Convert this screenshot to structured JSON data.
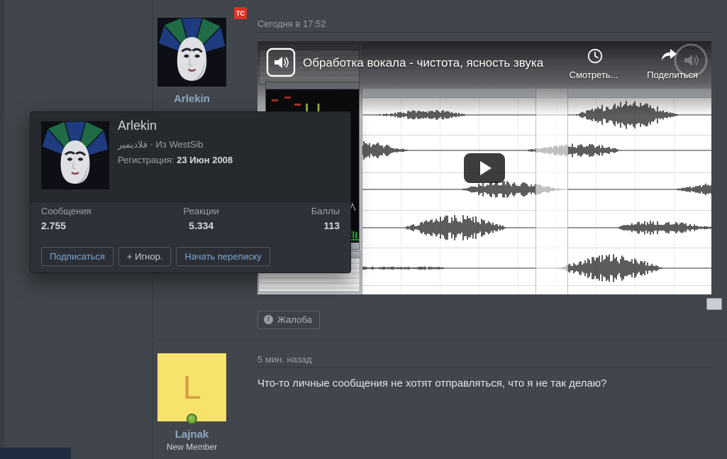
{
  "badge": {
    "label": "TC"
  },
  "post1": {
    "author": {
      "name": "Arlekin"
    },
    "timestamp": "Сегодня в 17:52",
    "video": {
      "title": "Обработка вокала - чистота, ясность звука",
      "watch_later_label": "Смотреть...",
      "share_label": "Поделиться"
    },
    "report_label": "Жалоба"
  },
  "profile_card": {
    "name": "Arlekin",
    "subtitle": "فلاديمير · Из WestSib",
    "registration_label": "Регистрация:",
    "registration_date": "23 Июн 2008",
    "stats": [
      {
        "label": "Сообщения",
        "value": "2.755"
      },
      {
        "label": "Реакции",
        "value": "5.334"
      },
      {
        "label": "Баллы",
        "value": "113"
      }
    ],
    "actions": [
      {
        "label": "Подписаться"
      },
      {
        "label": "+ Игнор."
      },
      {
        "label": "Начать переписку"
      }
    ]
  },
  "post2": {
    "author": {
      "name": "Lajnak",
      "title": "New Member",
      "avatar_letter": "L"
    },
    "timestamp": "5 мин. назад",
    "message": "Что-то личные сообщения не хотят отправляться, что я не так делаю?"
  }
}
